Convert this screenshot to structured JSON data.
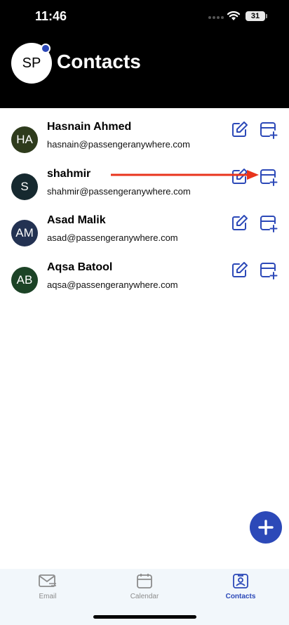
{
  "status_bar": {
    "time": "11:46",
    "battery": "31"
  },
  "header": {
    "avatar_initials": "SP",
    "title": "Contacts"
  },
  "contacts": [
    {
      "initials": "HA",
      "name": "Hasnain Ahmed",
      "email": "hasnain@passengeranywhere.com",
      "avatar_color": "#2e3b1c"
    },
    {
      "initials": "S",
      "name": "shahmir",
      "email": "shahmir@passengeranywhere.com",
      "avatar_color": "#16292f"
    },
    {
      "initials": "AM",
      "name": "Asad Malik",
      "email": "asad@passengeranywhere.com",
      "avatar_color": "#233252"
    },
    {
      "initials": "AB",
      "name": "Aqsa Batool",
      "email": "aqsa@passengeranywhere.com",
      "avatar_color": "#1c4326"
    }
  ],
  "row_icons": {
    "edit": "edit-icon",
    "add_event": "calendar-add-icon"
  },
  "fab_icon": "plus-icon",
  "tabs": [
    {
      "label": "Email",
      "icon": "email-icon",
      "active": false
    },
    {
      "label": "Calendar",
      "icon": "calendar-icon",
      "active": false
    },
    {
      "label": "Contacts",
      "icon": "contacts-icon",
      "active": true
    }
  ],
  "colors": {
    "accent": "#2c49b8",
    "header_bg": "#000000",
    "arrow": "#e8341c",
    "tabbar_bg": "#f2f7fb"
  }
}
